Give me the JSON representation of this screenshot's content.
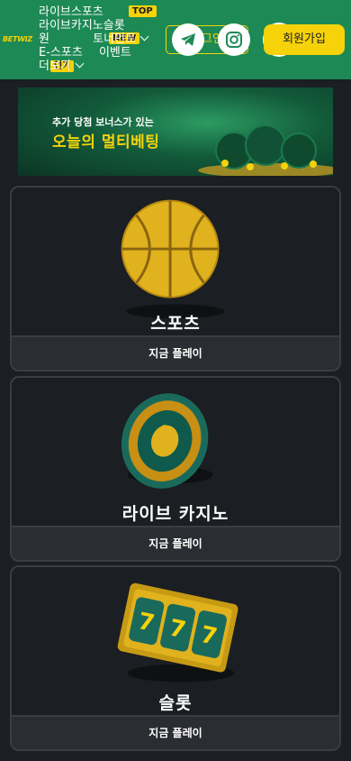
{
  "header": {
    "logo": "BETWIZ",
    "nav": {
      "live_sports": "라이브스포츠",
      "live_casino": "라이브카지노",
      "slots_frag": "슬롯",
      "hot_prefix": "원",
      "tournament": "토너먼트",
      "esports": "E-스포츠",
      "events": "이벤트",
      "more": "더보기"
    },
    "badges": {
      "top": "TOP",
      "new": "NEW",
      "hot": "인기"
    },
    "login_label": "로그인",
    "join_label": "회원가입"
  },
  "banner": {
    "line1": "추가 당첨 보너스가 있는",
    "line2": "오늘의 멀티베팅"
  },
  "cards": [
    {
      "title": "스포츠",
      "cta": "지금 플레이"
    },
    {
      "title": "라이브 카지노",
      "cta": "지금 플레이"
    },
    {
      "title": "슬롯",
      "cta": "지금 플레이"
    }
  ],
  "colors": {
    "brand_green": "#1d8a55",
    "accent_yellow": "#f5d20a",
    "bg": "#1b1e22"
  }
}
